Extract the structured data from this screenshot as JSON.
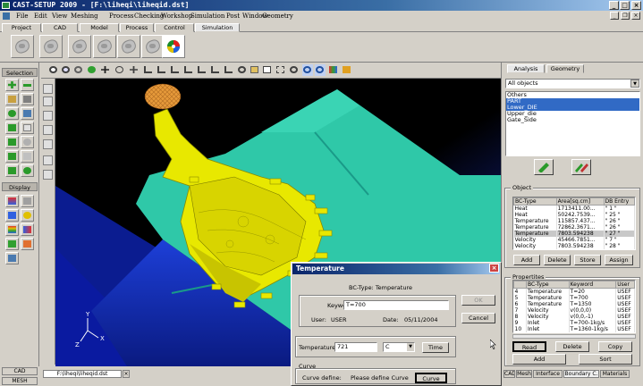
{
  "window": {
    "title": "CAST-SETUP 2009 - [F:\\liheqi\\liheqid.dst]",
    "min_label": "_",
    "max_label": "□",
    "close_label": "×"
  },
  "menu": [
    "File",
    "Edit",
    "View",
    "Meshing",
    "Process",
    "Checking",
    "Workshop",
    "Simulation",
    "Post",
    "Window",
    "Geometry"
  ],
  "menu_controls": {
    "min": "_",
    "restore": "❐",
    "close": "×"
  },
  "top_tabs": [
    "Project",
    "CAD",
    "Model",
    "Process",
    "Control",
    "Simulation"
  ],
  "left_panel": {
    "selection_label": "Selection",
    "display_label": "Display"
  },
  "right_panel": {
    "tabs": [
      "Analysis",
      "Geometry"
    ],
    "objects_dropdown": "All objects",
    "objects_list": [
      {
        "label": "Others",
        "selected": false
      },
      {
        "label": "PART",
        "selected": true
      },
      {
        "label": "Lower_DIE",
        "selected": true
      },
      {
        "label": "Upper_die",
        "selected": false
      },
      {
        "label": "Gate_Side",
        "selected": false
      }
    ],
    "object_group": {
      "title": "Object",
      "columns": [
        "BC-Type",
        "Area[sq.cm]",
        "DB Entry"
      ],
      "rows": [
        {
          "type": "Heat",
          "area": "1713411.00...",
          "db": "\" 1 \"",
          "selected": false
        },
        {
          "type": "Heat",
          "area": "50242.7539...",
          "db": "\" 25 \"",
          "selected": false
        },
        {
          "type": "Temperature",
          "area": "115857.437...",
          "db": "\" 26 \"",
          "selected": false
        },
        {
          "type": "Temperature",
          "area": "72862.3671...",
          "db": "\" 26 \"",
          "selected": false
        },
        {
          "type": "Temperature",
          "area": "7803.594238",
          "db": "\" 27 \"",
          "selected": true
        },
        {
          "type": "Velocity",
          "area": "45466.7851...",
          "db": "\" 7 \"",
          "selected": false
        },
        {
          "type": "Velocity",
          "area": "7803.594238",
          "db": "\" 28 \"",
          "selected": false
        }
      ],
      "buttons": [
        "Add",
        "Delete",
        "Store",
        "Assign"
      ]
    },
    "properties_group": {
      "title": "Propertites",
      "columns": [
        "",
        "BC-Type",
        "Keyword",
        "User"
      ],
      "rows": [
        {
          "n": "4",
          "type": "Temperature",
          "kw": "T=20",
          "user": "USEF"
        },
        {
          "n": "5",
          "type": "Temperature",
          "kw": "T=700",
          "user": "USEF"
        },
        {
          "n": "6",
          "type": "Temperature",
          "kw": "T=1350",
          "user": "USEF"
        },
        {
          "n": "7",
          "type": "Velocity",
          "kw": "v(0,0,0)",
          "user": "USEF"
        },
        {
          "n": "8",
          "type": "Velocity",
          "kw": "v(0,0,-1)",
          "user": "USEF"
        },
        {
          "n": "9",
          "type": "Inlet",
          "kw": "T=700-1kg/s",
          "user": "USEF"
        },
        {
          "n": "10",
          "type": "Inlet",
          "kw": "T=1360-1kg/s",
          "user": "USEF"
        }
      ],
      "buttons_row1": [
        "Read",
        "Delete",
        "Copy"
      ],
      "buttons_row2": [
        "Add",
        "Sort"
      ]
    },
    "bottom_tabs": [
      "CAD",
      "Mesh",
      "Interface",
      "Boundary C.",
      "Materials"
    ]
  },
  "bottom": {
    "cad_label": "CAD",
    "mesh_label": "MESH",
    "doc_tab": "F:\\liheqi\\liheqid.dst",
    "doc_close": "×"
  },
  "dialog": {
    "title": "Temperature",
    "bc_type": "BC-Type: Temperature",
    "keyword_label": "Keyword:",
    "keyword_value": "T=700",
    "user_label": "User:",
    "user_value": "USER",
    "date_label": "Date:",
    "date_value": "05/11/2004",
    "ok_label": "OK",
    "cancel_label": "Cancel",
    "temperature_label": "Temperature:",
    "temperature_value": "721",
    "unit_value": "C",
    "time_label": "Time",
    "curve_group": "Curve",
    "curve_define_label": "Curve define:",
    "curve_hint": "Please define Curve",
    "curve_button": "Curve"
  },
  "axis": {
    "y": "Y",
    "x": "X",
    "z": "Z"
  },
  "colors": {
    "titlebar": "#0a246a",
    "mold": "#2fc8a8",
    "part": "#e8e800",
    "viewport_bg": "#000000",
    "selection": "#316ac5"
  }
}
